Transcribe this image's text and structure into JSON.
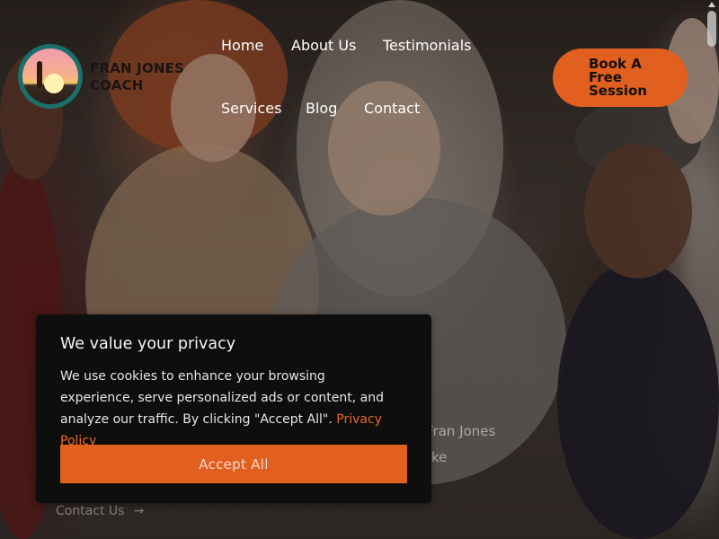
{
  "brand": {
    "line1": "FRAN JONES",
    "line2": "COACH"
  },
  "nav": {
    "home": "Home",
    "about": "About Us",
    "testimonials": "Testimonials",
    "services": "Services",
    "blog": "Blog",
    "contact": "Contact"
  },
  "cta": {
    "line1": "Book A",
    "line2": "Free",
    "line3": "Session"
  },
  "hero": {
    "partial_text_1": "Fran Jones",
    "partial_text_2": "ke",
    "contact_link": "Contact Us",
    "arrow": "→"
  },
  "cookie": {
    "title": "We value your privacy",
    "body": "We use cookies to enhance your browsing experience, serve personalized ads or content, and analyze our traffic. By clicking \"Accept All\".",
    "policy_link": "Privacy Policy",
    "accept_label": "Accept All"
  },
  "colors": {
    "accent": "#e15f1f",
    "dialog_bg": "#0f0e0e",
    "logo_ring": "#1b6f69"
  }
}
